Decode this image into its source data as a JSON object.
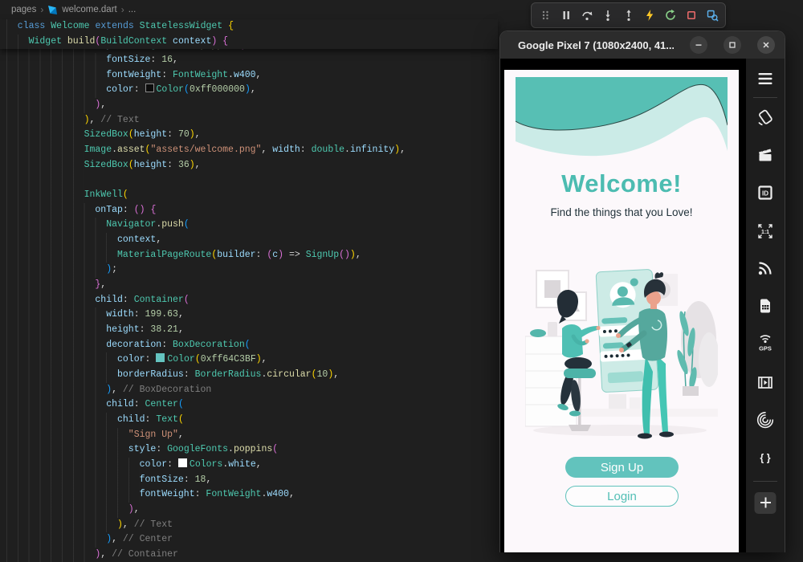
{
  "breadcrumb": {
    "items": [
      "pages",
      "welcome.dart",
      "..."
    ]
  },
  "editor": {
    "sticky": [
      {
        "ind": 1,
        "tokens": [
          {
            "t": "class ",
            "c": "kw"
          },
          {
            "t": "Welcome ",
            "c": "type"
          },
          {
            "t": "extends ",
            "c": "kw"
          },
          {
            "t": "StatelessWidget ",
            "c": "type"
          },
          {
            "t": "{",
            "c": "b1"
          }
        ]
      },
      {
        "ind": 2,
        "tokens": [
          {
            "t": "Widget ",
            "c": "type"
          },
          {
            "t": "build",
            "c": "fn"
          },
          {
            "t": "(",
            "c": "b2"
          },
          {
            "t": "BuildContext ",
            "c": "type"
          },
          {
            "t": "context",
            "c": "prop"
          },
          {
            "t": ") ",
            "c": "b2"
          },
          {
            "t": "{",
            "c": "b2"
          }
        ]
      }
    ],
    "lines": [
      {
        "ind": 8,
        "tokens": [
          {
            "t": "style",
            "c": "prop"
          },
          {
            "t": ": ",
            "c": "pn"
          },
          {
            "t": "GoogleFonts",
            "c": "type"
          },
          {
            "t": ".",
            "c": "pn"
          },
          {
            "t": "poppins",
            "c": "fn"
          },
          {
            "t": "(",
            "c": "b2"
          }
        ]
      },
      {
        "ind": 9,
        "tokens": [
          {
            "t": "fontSize",
            "c": "prop"
          },
          {
            "t": ": ",
            "c": "pn"
          },
          {
            "t": "16",
            "c": "num"
          },
          {
            "t": ",",
            "c": "pn"
          }
        ]
      },
      {
        "ind": 9,
        "tokens": [
          {
            "t": "fontWeight",
            "c": "prop"
          },
          {
            "t": ": ",
            "c": "pn"
          },
          {
            "t": "FontWeight",
            "c": "type"
          },
          {
            "t": ".",
            "c": "pn"
          },
          {
            "t": "w400",
            "c": "prop"
          },
          {
            "t": ",",
            "c": "pn"
          }
        ]
      },
      {
        "ind": 9,
        "tokens": [
          {
            "t": "color",
            "c": "prop"
          },
          {
            "t": ": ",
            "c": "pn"
          },
          {
            "sw": "#0c0c0c",
            "sb": "#8a8a8a"
          },
          {
            "t": "Color",
            "c": "type"
          },
          {
            "t": "(",
            "c": "b3"
          },
          {
            "t": "0xff000000",
            "c": "num"
          },
          {
            "t": ")",
            "c": "b3"
          },
          {
            "t": ",",
            "c": "pn"
          }
        ]
      },
      {
        "ind": 8,
        "tokens": [
          {
            "t": ")",
            "c": "b2"
          },
          {
            "t": ",",
            "c": "pn"
          }
        ]
      },
      {
        "ind": 7,
        "tokens": [
          {
            "t": ")",
            "c": "b1"
          },
          {
            "t": ",",
            "c": "pn"
          },
          {
            "t": " // Text",
            "c": "cmt"
          }
        ]
      },
      {
        "ind": 7,
        "tokens": [
          {
            "t": "SizedBox",
            "c": "type"
          },
          {
            "t": "(",
            "c": "b1"
          },
          {
            "t": "height",
            "c": "prop"
          },
          {
            "t": ": ",
            "c": "pn"
          },
          {
            "t": "70",
            "c": "num"
          },
          {
            "t": ")",
            "c": "b1"
          },
          {
            "t": ",",
            "c": "pn"
          }
        ]
      },
      {
        "ind": 7,
        "tokens": [
          {
            "t": "Image",
            "c": "type"
          },
          {
            "t": ".",
            "c": "pn"
          },
          {
            "t": "asset",
            "c": "fn"
          },
          {
            "t": "(",
            "c": "b1"
          },
          {
            "t": "\"assets/welcome.png\"",
            "c": "str"
          },
          {
            "t": ", ",
            "c": "pn"
          },
          {
            "t": "width",
            "c": "prop"
          },
          {
            "t": ": ",
            "c": "pn"
          },
          {
            "t": "double",
            "c": "type"
          },
          {
            "t": ".",
            "c": "pn"
          },
          {
            "t": "infinity",
            "c": "prop"
          },
          {
            "t": ")",
            "c": "b1"
          },
          {
            "t": ",",
            "c": "pn"
          }
        ]
      },
      {
        "ind": 7,
        "tokens": [
          {
            "t": "SizedBox",
            "c": "type"
          },
          {
            "t": "(",
            "c": "b1"
          },
          {
            "t": "height",
            "c": "prop"
          },
          {
            "t": ": ",
            "c": "pn"
          },
          {
            "t": "36",
            "c": "num"
          },
          {
            "t": ")",
            "c": "b1"
          },
          {
            "t": ",",
            "c": "pn"
          }
        ]
      },
      {
        "ind": 7,
        "tokens": []
      },
      {
        "ind": 7,
        "tokens": [
          {
            "t": "InkWell",
            "c": "type"
          },
          {
            "t": "(",
            "c": "b1"
          }
        ]
      },
      {
        "ind": 8,
        "tokens": [
          {
            "t": "onTap",
            "c": "prop"
          },
          {
            "t": ": ",
            "c": "pn"
          },
          {
            "t": "() ",
            "c": "b2"
          },
          {
            "t": "{",
            "c": "b2"
          }
        ]
      },
      {
        "ind": 9,
        "tokens": [
          {
            "t": "Navigator",
            "c": "type"
          },
          {
            "t": ".",
            "c": "pn"
          },
          {
            "t": "push",
            "c": "fn"
          },
          {
            "t": "(",
            "c": "b3"
          }
        ]
      },
      {
        "ind": 10,
        "tokens": [
          {
            "t": "context",
            "c": "prop"
          },
          {
            "t": ",",
            "c": "pn"
          }
        ]
      },
      {
        "ind": 10,
        "tokens": [
          {
            "t": "MaterialPageRoute",
            "c": "type"
          },
          {
            "t": "(",
            "c": "b1"
          },
          {
            "t": "builder",
            "c": "prop"
          },
          {
            "t": ": ",
            "c": "pn"
          },
          {
            "t": "(",
            "c": "b2"
          },
          {
            "t": "c",
            "c": "prop"
          },
          {
            "t": ")",
            "c": "b2"
          },
          {
            "t": " => ",
            "c": "pn"
          },
          {
            "t": "SignUp",
            "c": "type"
          },
          {
            "t": "()",
            "c": "b2"
          },
          {
            "t": ")",
            "c": "b1"
          },
          {
            "t": ",",
            "c": "pn"
          }
        ]
      },
      {
        "ind": 9,
        "tokens": [
          {
            "t": ")",
            "c": "b3"
          },
          {
            "t": ";",
            "c": "pn"
          }
        ]
      },
      {
        "ind": 8,
        "tokens": [
          {
            "t": "}",
            "c": "b2"
          },
          {
            "t": ",",
            "c": "pn"
          }
        ]
      },
      {
        "ind": 8,
        "tokens": [
          {
            "t": "child",
            "c": "prop"
          },
          {
            "t": ": ",
            "c": "pn"
          },
          {
            "t": "Container",
            "c": "type"
          },
          {
            "t": "(",
            "c": "b2"
          }
        ]
      },
      {
        "ind": 9,
        "tokens": [
          {
            "t": "width",
            "c": "prop"
          },
          {
            "t": ": ",
            "c": "pn"
          },
          {
            "t": "199.63",
            "c": "num"
          },
          {
            "t": ",",
            "c": "pn"
          }
        ]
      },
      {
        "ind": 9,
        "tokens": [
          {
            "t": "height",
            "c": "prop"
          },
          {
            "t": ": ",
            "c": "pn"
          },
          {
            "t": "38.21",
            "c": "num"
          },
          {
            "t": ",",
            "c": "pn"
          }
        ]
      },
      {
        "ind": 9,
        "tokens": [
          {
            "t": "decoration",
            "c": "prop"
          },
          {
            "t": ": ",
            "c": "pn"
          },
          {
            "t": "BoxDecoration",
            "c": "type"
          },
          {
            "t": "(",
            "c": "b3"
          }
        ]
      },
      {
        "ind": 10,
        "tokens": [
          {
            "t": "color",
            "c": "prop"
          },
          {
            "t": ": ",
            "c": "pn"
          },
          {
            "sw": "#64C3BF"
          },
          {
            "t": "Color",
            "c": "type"
          },
          {
            "t": "(",
            "c": "b1"
          },
          {
            "t": "0xff64C3BF",
            "c": "num"
          },
          {
            "t": ")",
            "c": "b1"
          },
          {
            "t": ",",
            "c": "pn"
          }
        ]
      },
      {
        "ind": 10,
        "tokens": [
          {
            "t": "borderRadius",
            "c": "prop"
          },
          {
            "t": ": ",
            "c": "pn"
          },
          {
            "t": "BorderRadius",
            "c": "type"
          },
          {
            "t": ".",
            "c": "pn"
          },
          {
            "t": "circular",
            "c": "fn"
          },
          {
            "t": "(",
            "c": "b1"
          },
          {
            "t": "10",
            "c": "num"
          },
          {
            "t": ")",
            "c": "b1"
          },
          {
            "t": ",",
            "c": "pn"
          }
        ]
      },
      {
        "ind": 9,
        "tokens": [
          {
            "t": ")",
            "c": "b3"
          },
          {
            "t": ",",
            "c": "pn"
          },
          {
            "t": " // BoxDecoration",
            "c": "cmt"
          }
        ]
      },
      {
        "ind": 9,
        "tokens": [
          {
            "t": "child",
            "c": "prop"
          },
          {
            "t": ": ",
            "c": "pn"
          },
          {
            "t": "Center",
            "c": "type"
          },
          {
            "t": "(",
            "c": "b3"
          }
        ]
      },
      {
        "ind": 10,
        "tokens": [
          {
            "t": "child",
            "c": "prop"
          },
          {
            "t": ": ",
            "c": "pn"
          },
          {
            "t": "Text",
            "c": "type"
          },
          {
            "t": "(",
            "c": "b1"
          }
        ]
      },
      {
        "ind": 11,
        "tokens": [
          {
            "t": "\"Sign Up\"",
            "c": "str"
          },
          {
            "t": ",",
            "c": "pn"
          }
        ]
      },
      {
        "ind": 11,
        "tokens": [
          {
            "t": "style",
            "c": "prop"
          },
          {
            "t": ": ",
            "c": "pn"
          },
          {
            "t": "GoogleFonts",
            "c": "type"
          },
          {
            "t": ".",
            "c": "pn"
          },
          {
            "t": "poppins",
            "c": "fn"
          },
          {
            "t": "(",
            "c": "b2"
          }
        ]
      },
      {
        "ind": 12,
        "tokens": [
          {
            "t": "color",
            "c": "prop"
          },
          {
            "t": ": ",
            "c": "pn"
          },
          {
            "sw": "#ffffff"
          },
          {
            "t": "Colors",
            "c": "type"
          },
          {
            "t": ".",
            "c": "pn"
          },
          {
            "t": "white",
            "c": "prop"
          },
          {
            "t": ",",
            "c": "pn"
          }
        ]
      },
      {
        "ind": 12,
        "tokens": [
          {
            "t": "fontSize",
            "c": "prop"
          },
          {
            "t": ": ",
            "c": "pn"
          },
          {
            "t": "18",
            "c": "num"
          },
          {
            "t": ",",
            "c": "pn"
          }
        ]
      },
      {
        "ind": 12,
        "tokens": [
          {
            "t": "fontWeight",
            "c": "prop"
          },
          {
            "t": ": ",
            "c": "pn"
          },
          {
            "t": "FontWeight",
            "c": "type"
          },
          {
            "t": ".",
            "c": "pn"
          },
          {
            "t": "w400",
            "c": "prop"
          },
          {
            "t": ",",
            "c": "pn"
          }
        ]
      },
      {
        "ind": 11,
        "tokens": [
          {
            "t": ")",
            "c": "b2"
          },
          {
            "t": ",",
            "c": "pn"
          }
        ]
      },
      {
        "ind": 10,
        "tokens": [
          {
            "t": ")",
            "c": "b1"
          },
          {
            "t": ",",
            "c": "pn"
          },
          {
            "t": " // Text",
            "c": "cmt"
          }
        ]
      },
      {
        "ind": 9,
        "tokens": [
          {
            "t": ")",
            "c": "b3"
          },
          {
            "t": ",",
            "c": "pn"
          },
          {
            "t": " // Center",
            "c": "cmt"
          }
        ]
      },
      {
        "ind": 8,
        "tokens": [
          {
            "t": ")",
            "c": "b2"
          },
          {
            "t": ",",
            "c": "pn"
          },
          {
            "t": " // Container",
            "c": "cmt"
          }
        ]
      }
    ]
  },
  "debug_toolbar": {
    "icons": [
      "grip",
      "pause",
      "step-over",
      "step-into",
      "step-out",
      "hot-reload",
      "restart",
      "stop",
      "inspect"
    ]
  },
  "emulator": {
    "title": "Google Pixel 7 (1080x2400, 41...",
    "window_buttons": [
      "minimize",
      "maximize",
      "close"
    ],
    "sidebar_icons": [
      "menu",
      "rotate",
      "clapperboard",
      "device-id",
      "one-to-one",
      "signal",
      "sim-card",
      "gps",
      "screen-record",
      "fingerprint",
      "dev-braces",
      "add"
    ],
    "app": {
      "title": "Welcome!",
      "subtitle": "Find the things that you Love!",
      "signup_label": "Sign Up",
      "login_label": "Login",
      "accent_color": "#64C3BF",
      "title_color": "#4CBCB1",
      "wave_dark": "#57BFB4",
      "wave_light": "#CBEBE7",
      "screen_bg": "#FCF8FB"
    }
  }
}
